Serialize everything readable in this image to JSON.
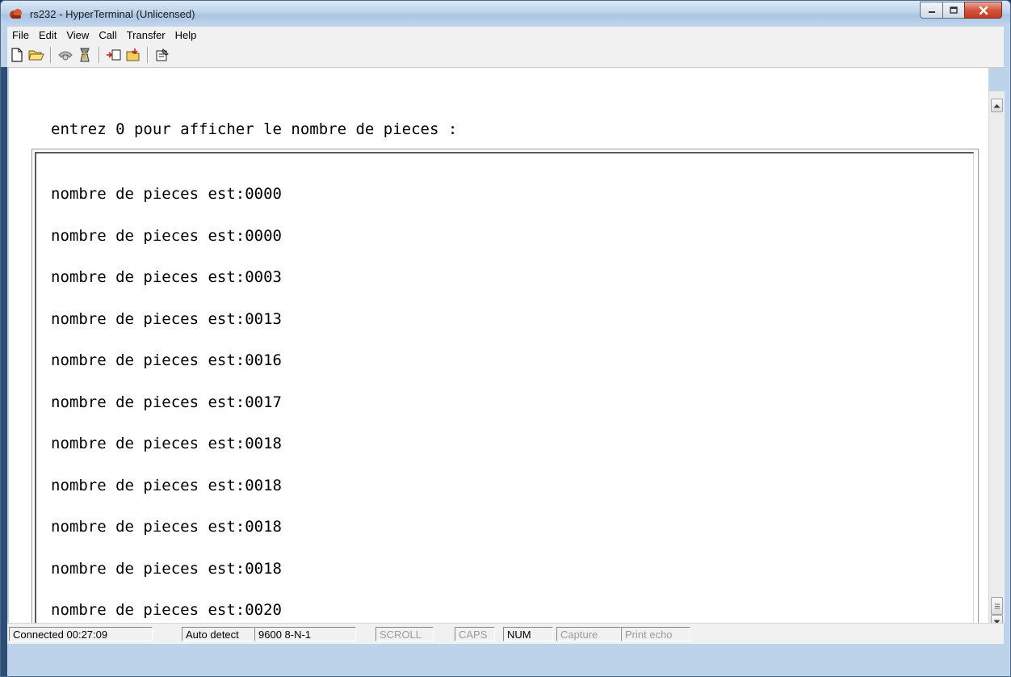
{
  "window": {
    "title": "rs232 - HyperTerminal (Unlicensed)"
  },
  "menu": [
    "File",
    "Edit",
    "View",
    "Call",
    "Transfer",
    "Help"
  ],
  "toolbar": {
    "icons": [
      "new-file-icon",
      "open-folder-icon",
      "phone-disconnect-icon",
      "disconnect-icon",
      "send-icon",
      "receive-icon",
      "properties-icon"
    ]
  },
  "terminal": {
    "prompt_line": "entrez 0 pour afficher le nombre de pieces :",
    "lines": [
      "nombre de pieces est:0000",
      "nombre de pieces est:0000",
      "nombre de pieces est:0003",
      "nombre de pieces est:0013",
      "nombre de pieces est:0016",
      "nombre de pieces est:0017",
      "nombre de pieces est:0018",
      "nombre de pieces est:0018",
      "nombre de pieces est:0018",
      "nombre de pieces est:0018",
      "nombre de pieces est:0020"
    ]
  },
  "status": {
    "connected": "Connected 00:27:09",
    "detect": "Auto detect",
    "port": "9600 8-N-1",
    "scroll": "SCROLL",
    "caps": "CAPS",
    "num": "NUM",
    "capture": "Capture",
    "print_echo": "Print echo"
  },
  "colors": {
    "title_gradient": "#bcd2ea",
    "close_button": "#c43a22"
  }
}
